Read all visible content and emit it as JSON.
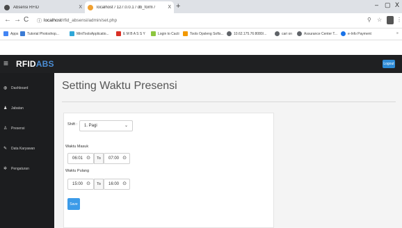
{
  "browser": {
    "tabs": [
      {
        "label": "Absensi RFID",
        "close": "X",
        "favicon_color": "#4a4a4a"
      },
      {
        "label": "localhost / 127.0.0.1 / db_form / ",
        "close": "X",
        "favicon_color": "#f0a030"
      }
    ],
    "new_tab": "+",
    "window_controls": {
      "minimize": "–",
      "maximize": "▢",
      "close": "X"
    },
    "url": {
      "host": "localhost",
      "path": "/rfid_absensi/admin/set.php"
    },
    "bookmarks": [
      {
        "label": "Apps",
        "color": "#4285f4"
      },
      {
        "label": "Tutorial Photoshop...",
        "color": "#3b7bd4"
      },
      {
        "label": "MiniToolsApplicatio...",
        "color": "#2fa7d8"
      },
      {
        "label": "E M B A S S Y",
        "color": "#d93025"
      },
      {
        "label": "Login to Cacti",
        "color": "#8dc63f"
      },
      {
        "label": "Tools Opsleng Softs...",
        "color": "#f29900"
      },
      {
        "label": "10.62.175.76:8080/...",
        "color": "#5f6368"
      },
      {
        "label": "cari on",
        "color": "#5f6368"
      },
      {
        "label": "Assurance Center T...",
        "color": "#5f6368"
      },
      {
        "label": "e-Info Payment",
        "color": "#1a73e8"
      }
    ]
  },
  "app": {
    "brand_part1": "RFID",
    "brand_part2": "ABS",
    "logout_label": "Logout",
    "sidebar": [
      {
        "label": "Dashboard",
        "icon": "dashboard-icon",
        "glyph": "◍"
      },
      {
        "label": "Jabatan",
        "icon": "users-icon",
        "glyph": "♟"
      },
      {
        "label": "Presensi",
        "icon": "user-icon",
        "glyph": "♙"
      },
      {
        "label": "Data Karyawan",
        "icon": "edit-icon",
        "glyph": "✎"
      },
      {
        "label": "Pengaturan",
        "icon": "gear-icon",
        "glyph": "✲"
      }
    ],
    "page_title": "Setting Waktu Presensi",
    "form": {
      "shift_label": "Shift :",
      "shift_value": "1. Pagi",
      "masuk_label": "Waktu Masuk",
      "masuk_from": "06:01",
      "masuk_to": "07:00",
      "pulang_label": "Waktu Pulang",
      "pulang_from": "15:00",
      "pulang_to": "16:00",
      "to_label": "To",
      "save_label": "Save"
    }
  },
  "colors": {
    "accent": "#4b8ed6",
    "button": "#3c9be8",
    "navbar": "#1f2022",
    "sidebar": "#1c1d1f"
  }
}
